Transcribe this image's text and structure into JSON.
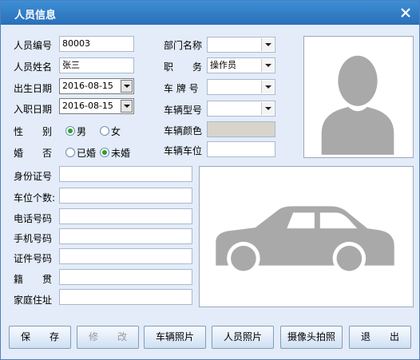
{
  "window": {
    "title": "人员信息"
  },
  "form": {
    "person_id": {
      "label": "人员编号",
      "value": "80003"
    },
    "person_name": {
      "label": "人员姓名",
      "value": "张三"
    },
    "birth_date": {
      "label": "出生日期",
      "value": "2016-08-15"
    },
    "hire_date": {
      "label": "入职日期",
      "value": "2016-08-15"
    },
    "gender": {
      "label": "性　　别",
      "options": [
        "男",
        "女"
      ],
      "selected": "男"
    },
    "marital": {
      "label": "婚　　否",
      "options": [
        "已婚",
        "未婚"
      ],
      "selected": "未婚"
    },
    "department": {
      "label": "部门名称",
      "value": ""
    },
    "position": {
      "label": "职　　务",
      "value": "操作员"
    },
    "plate": {
      "label": "车 牌 号",
      "value": ""
    },
    "model": {
      "label": "车辆型号",
      "value": ""
    },
    "color": {
      "label": "车辆颜色",
      "value": ""
    },
    "parking": {
      "label": "车辆车位",
      "value": ""
    },
    "id_card": {
      "label": "身份证号",
      "value": ""
    },
    "space_count": {
      "label": "车位个数:",
      "value": ""
    },
    "phone": {
      "label": "电话号码",
      "value": ""
    },
    "mobile": {
      "label": "手机号码",
      "value": ""
    },
    "cert_no": {
      "label": "证件号码",
      "value": ""
    },
    "native": {
      "label": "籍　　贯",
      "value": ""
    },
    "address": {
      "label": "家庭住址",
      "value": ""
    }
  },
  "buttons": {
    "save": "保　　存",
    "modify": "修　　改",
    "vehicle_photo": "车辆照片",
    "person_photo": "人员照片",
    "camera": "摄像头拍照",
    "exit": "退　　出"
  },
  "icons": {
    "photo_placeholder": "person-silhouette-icon",
    "car_placeholder": "car-silhouette-icon"
  }
}
